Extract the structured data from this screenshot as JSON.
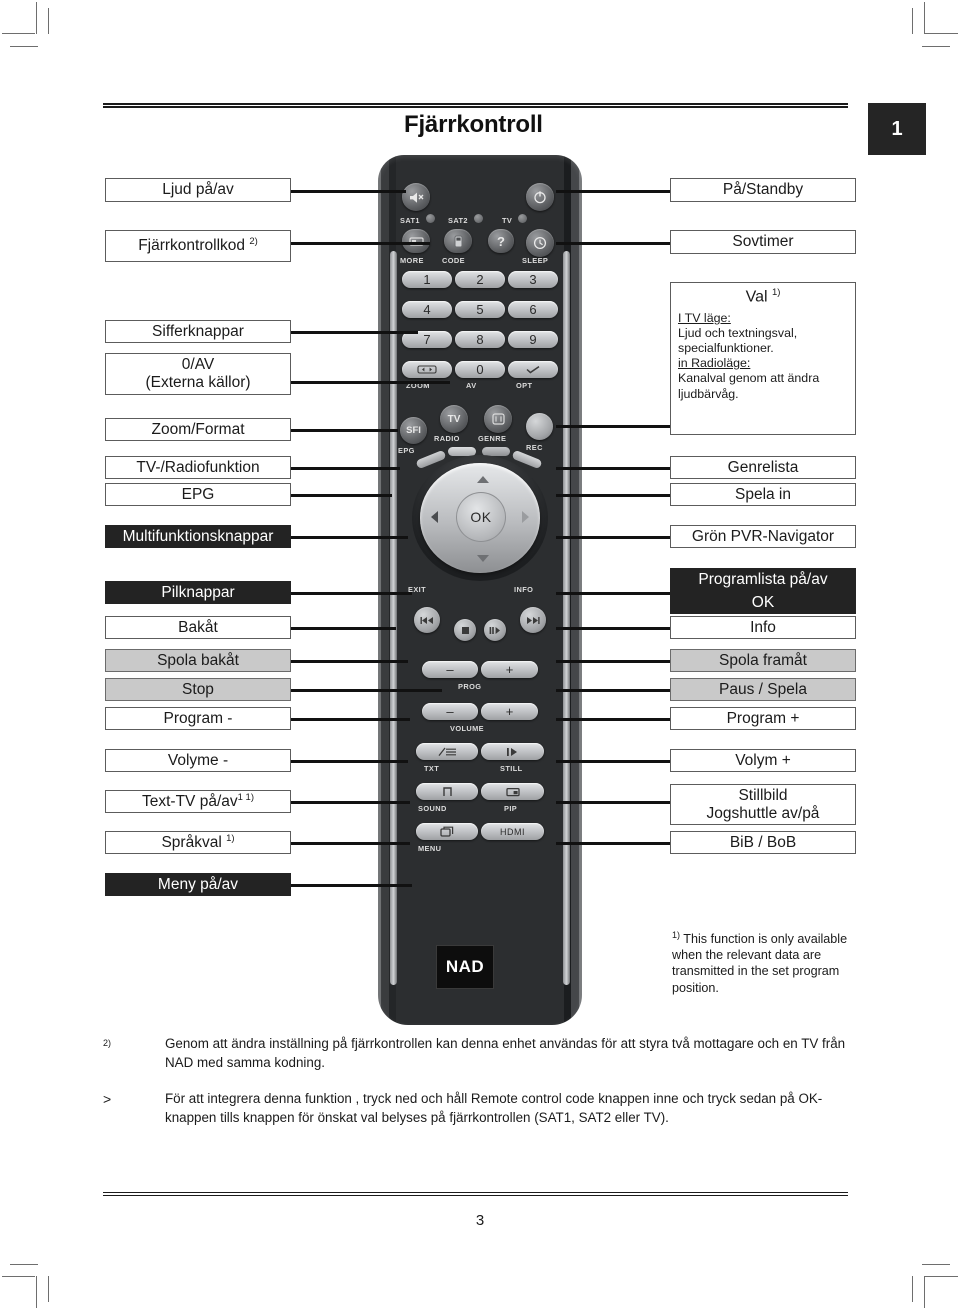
{
  "header": {
    "title": "Fjärrkontroll",
    "chapter_badge": "1"
  },
  "page_number": "3",
  "left_labels": [
    {
      "id": "ljud-pa-av",
      "lines": [
        "Ljud på/av"
      ],
      "style": "white"
    },
    {
      "id": "fjarrkontrollkod",
      "lines": [
        "Fjärrkontrollkod"
      ],
      "sup": "2)",
      "style": "white"
    },
    {
      "id": "sifferknappar",
      "lines": [
        "Sifferknappar"
      ],
      "style": "white"
    },
    {
      "id": "0-av-externa-kallor",
      "lines": [
        "0/AV",
        "(Externa källor)"
      ],
      "style": "white"
    },
    {
      "id": "zoom-format",
      "lines": [
        "Zoom/Format"
      ],
      "style": "white"
    },
    {
      "id": "tv-radiofunktion",
      "lines": [
        "TV-/Radiofunktion"
      ],
      "style": "white"
    },
    {
      "id": "epg",
      "lines": [
        "EPG"
      ],
      "style": "white"
    },
    {
      "id": "multifunktionsknappar",
      "lines": [
        "Multifunktionsknappar"
      ],
      "style": "dark"
    },
    {
      "id": "pilknappar",
      "lines": [
        "Pilknappar"
      ],
      "style": "dark"
    },
    {
      "id": "bakat",
      "lines": [
        "Bakåt"
      ],
      "style": "white"
    },
    {
      "id": "spola-bakat",
      "lines": [
        "Spola bakåt"
      ],
      "style": "gray"
    },
    {
      "id": "stop",
      "lines": [
        "Stop"
      ],
      "style": "gray"
    },
    {
      "id": "program-minus",
      "lines": [
        "Program -"
      ],
      "style": "white"
    },
    {
      "id": "volyme-minus",
      "lines": [
        "Volyme -"
      ],
      "style": "white"
    },
    {
      "id": "text-tv-pa-av",
      "lines": [
        "Text-TV på/av"
      ],
      "sup": "1 1)",
      "style": "white"
    },
    {
      "id": "sprakval",
      "lines": [
        "Språkval"
      ],
      "sup": "1)",
      "style": "white"
    },
    {
      "id": "meny-pa-av",
      "lines": [
        "Meny på/av"
      ],
      "style": "dark"
    }
  ],
  "right_labels": [
    {
      "id": "pa-standby",
      "lines": [
        "På/Standby"
      ],
      "style": "white"
    },
    {
      "id": "sovtimer",
      "lines": [
        "Sovtimer"
      ],
      "style": "white"
    },
    {
      "id": "genrelista",
      "lines": [
        "Genrelista"
      ],
      "style": "white"
    },
    {
      "id": "spela-in",
      "lines": [
        "Spela in"
      ],
      "style": "white"
    },
    {
      "id": "gron-pvr-navigator",
      "lines": [
        "Grön PVR-Navigator"
      ],
      "style": "white"
    },
    {
      "id": "programlista-pa-av",
      "lines": [
        "Programlista på/av"
      ],
      "style": "dark"
    },
    {
      "id": "ok",
      "lines": [
        "OK"
      ],
      "style": "dark"
    },
    {
      "id": "info",
      "lines": [
        "Info"
      ],
      "style": "white"
    },
    {
      "id": "spola-framat",
      "lines": [
        "Spola framåt"
      ],
      "style": "gray"
    },
    {
      "id": "paus-spela",
      "lines": [
        "Paus / Spela"
      ],
      "style": "gray"
    },
    {
      "id": "program-plus",
      "lines": [
        "Program +"
      ],
      "style": "white"
    },
    {
      "id": "volym-plus",
      "lines": [
        "Volym +"
      ],
      "style": "white"
    },
    {
      "id": "stillbild",
      "lines": [
        "Stillbild",
        "Jogshuttle av/på"
      ],
      "style": "white"
    },
    {
      "id": "bib-bob",
      "lines": [
        "BiB / BoB"
      ],
      "style": "white"
    }
  ],
  "val_box": {
    "heading": "Val",
    "heading_sup": "1)",
    "sub1": "I TV läge:",
    "body1_line1": "Ljud och textningsval,",
    "body1_line2": "specialfunktioner.",
    "sub2": "in Radioläge:",
    "body2_line1": "Kanalval genom att ändra",
    "body2_line2": "ljudbärvåg."
  },
  "footnote_1": {
    "marker": "1)",
    "text": "This function is only available when the relevant data are transmitted in the set program position."
  },
  "paragraphs": [
    {
      "id": "note-2",
      "marker": "2)",
      "text": "Genom att ändra inställning på fjärrkontrollen kan denna enhet användas för att styra två mottagare och en TV från NAD med samma kodning."
    },
    {
      "id": "note-arrow",
      "marker": ">",
      "text": "För att integrera denna funktion , tryck ned och håll Remote control code knappen inne och tryck sedan på OK-knappen tills knappen för önskat val belyses på fjärrkontrollen (SAT1, SAT2 eller TV)."
    }
  ],
  "remote": {
    "brand": "NAD",
    "ok_label": "OK",
    "led_labels": [
      "SAT1",
      "SAT2",
      "TV"
    ],
    "row2_labels": [
      "MORE",
      "CODE",
      "SLEEP"
    ],
    "help_glyph": "?",
    "digits": [
      "1",
      "2",
      "3",
      "4",
      "5",
      "6",
      "7",
      "8",
      "9",
      "0"
    ],
    "zero_row_labels": [
      "ZOOM",
      "AV",
      "OPT"
    ],
    "mode_labels": [
      "EPG",
      "RADIO",
      "GENRE",
      "REC"
    ],
    "mode_glyphs": [
      "SFI",
      "TV"
    ],
    "nav_side_labels": [
      "EXIT",
      "INFO"
    ],
    "prog_label": "PROG",
    "volume_label": "VOLUME",
    "minus": "–",
    "plus": "+",
    "bottom_labels": [
      "TXT",
      "STILL",
      "SOUND",
      "PIP",
      "MENU",
      "HDMI"
    ]
  },
  "colors": {
    "ink": "#1b1b1b",
    "box_border": "#5c5c5c",
    "dark_fill": "#232323",
    "gray_fill": "#c9c9c9",
    "badge_fill": "#252525"
  }
}
